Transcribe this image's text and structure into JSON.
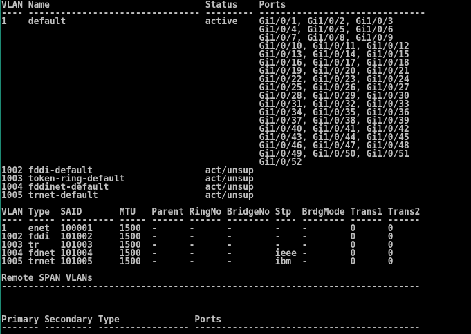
{
  "terminal": {
    "lines": [
      "VLAN Name                             Status    Ports",
      "---- -------------------------------- --------- -------------------------------",
      "1    default                          active    Gi1/0/1, Gi1/0/2, Gi1/0/3",
      "                                                Gi1/0/4, Gi1/0/5, Gi1/0/6",
      "                                                Gi1/0/7, Gi1/0/8, Gi1/0/9",
      "                                                Gi1/0/10, Gi1/0/11, Gi1/0/12",
      "                                                Gi1/0/13, Gi1/0/14, Gi1/0/15",
      "                                                Gi1/0/16, Gi1/0/17, Gi1/0/18",
      "                                                Gi1/0/19, Gi1/0/20, Gi1/0/21",
      "                                                Gi1/0/22, Gi1/0/23, Gi1/0/24",
      "                                                Gi1/0/25, Gi1/0/26, Gi1/0/27",
      "                                                Gi1/0/28, Gi1/0/29, Gi1/0/30",
      "                                                Gi1/0/31, Gi1/0/32, Gi1/0/33",
      "                                                Gi1/0/34, Gi1/0/35, Gi1/0/36",
      "                                                Gi1/0/37, Gi1/0/38, Gi1/0/39",
      "                                                Gi1/0/40, Gi1/0/41, Gi1/0/42",
      "                                                Gi1/0/43, Gi1/0/44, Gi1/0/45",
      "                                                Gi1/0/46, Gi1/0/47, Gi1/0/48",
      "                                                Gi1/0/49, Gi1/0/50, Gi1/0/51",
      "                                                Gi1/0/52",
      "1002 fddi-default                     act/unsup",
      "1003 token-ring-default               act/unsup",
      "1004 fddinet-default                  act/unsup",
      "1005 trnet-default                    act/unsup",
      "",
      "VLAN Type  SAID       MTU   Parent RingNo BridgeNo Stp  BrdgMode Trans1 Trans2",
      "---- ----- ---------- ----- ------ ------ -------- ---- -------- ------ ------",
      "1    enet  100001     1500  -      -      -        -    -        0      0",
      "1002 fddi  101002     1500  -      -      -        -    -        0      0",
      "1003 tr    101003     1500  -      -      -        -    -        0      0",
      "1004 fdnet 101004     1500  -      -      -        ieee -        0      0",
      "1005 trnet 101005     1500  -      -      -        ibm  -        0      0",
      "",
      "Remote SPAN VLANs",
      "------------------------------------------------------------------------------",
      "",
      "",
      "",
      "Primary Secondary Type              Ports",
      "------- --------- ----------------- ------------------------------------------"
    ]
  },
  "colors": {
    "background": "#000000",
    "foreground": "#c0c0c0",
    "border": "#1e8a74"
  }
}
